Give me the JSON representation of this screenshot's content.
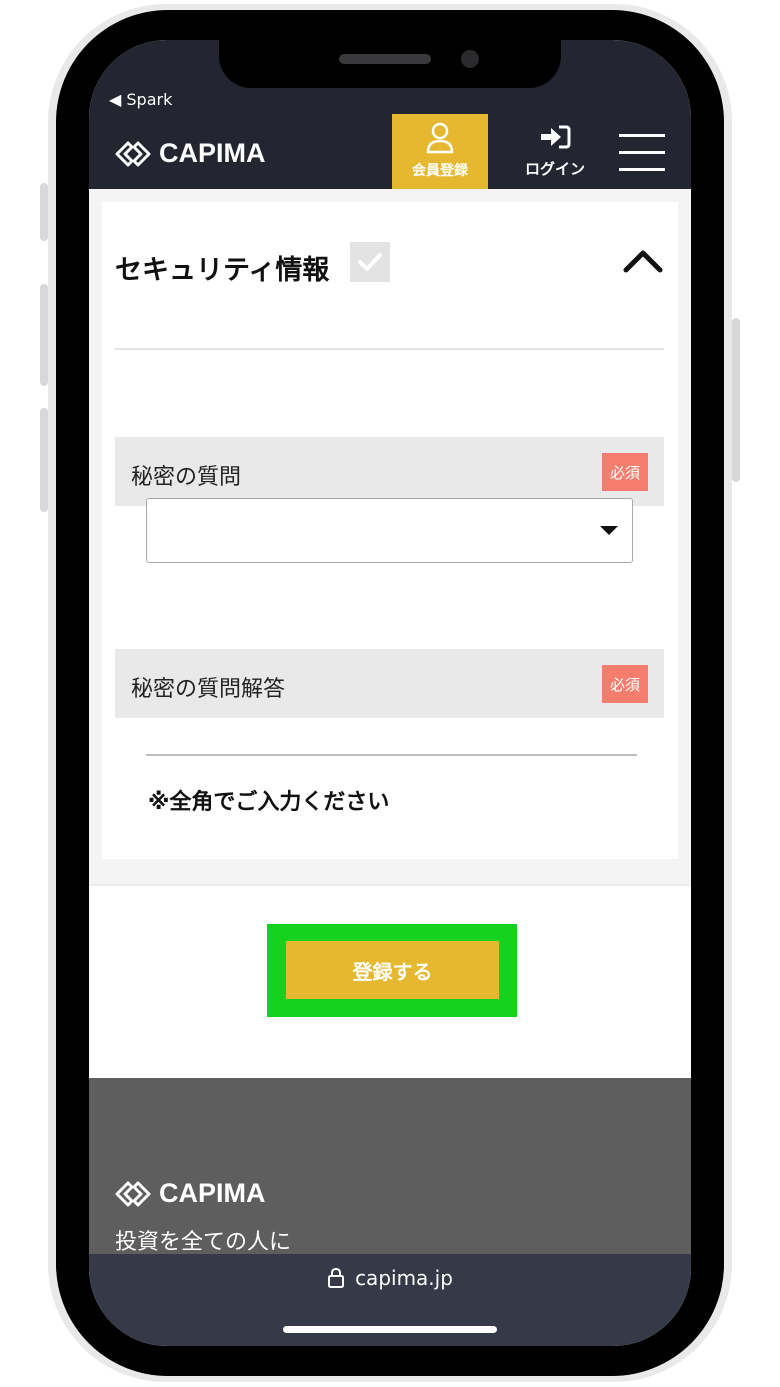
{
  "status_bar": {
    "back_label": "◀ Spark"
  },
  "header": {
    "logo_text": "CAPIMA",
    "register_label": "会員登録",
    "login_label": "ログイン",
    "colors": {
      "bar": "#232530",
      "accent": "#e6b830"
    }
  },
  "form": {
    "section_title": "セキュリティ情報",
    "fields": [
      {
        "label": "秘密の質問",
        "badge": "必須",
        "selected_value": ""
      },
      {
        "label": "秘密の質問解答",
        "badge": "必須",
        "value": ""
      }
    ],
    "note": "※全角でご入力ください",
    "submit_label": "登録する"
  },
  "footer": {
    "logo_text": "CAPIMA",
    "tagline": "投資を全ての人に"
  },
  "browser": {
    "url": "capima.jp"
  }
}
